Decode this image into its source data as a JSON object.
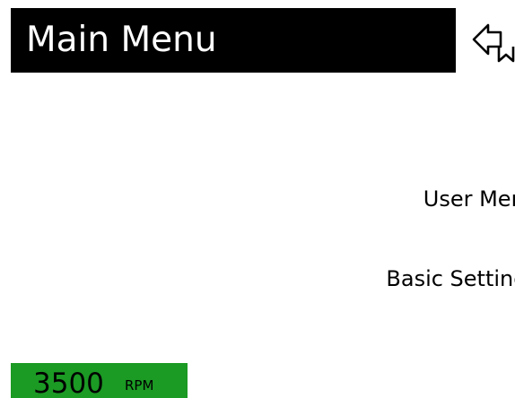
{
  "header": {
    "title": "Main Menu",
    "back_icon": "back-arrow-icon"
  },
  "menu": {
    "items": [
      {
        "label": "User Menu"
      },
      {
        "label": "Basic Settings"
      }
    ]
  },
  "status": {
    "rpm_value": "3500",
    "rpm_unit": "RPM",
    "color": "#1b9a24"
  }
}
